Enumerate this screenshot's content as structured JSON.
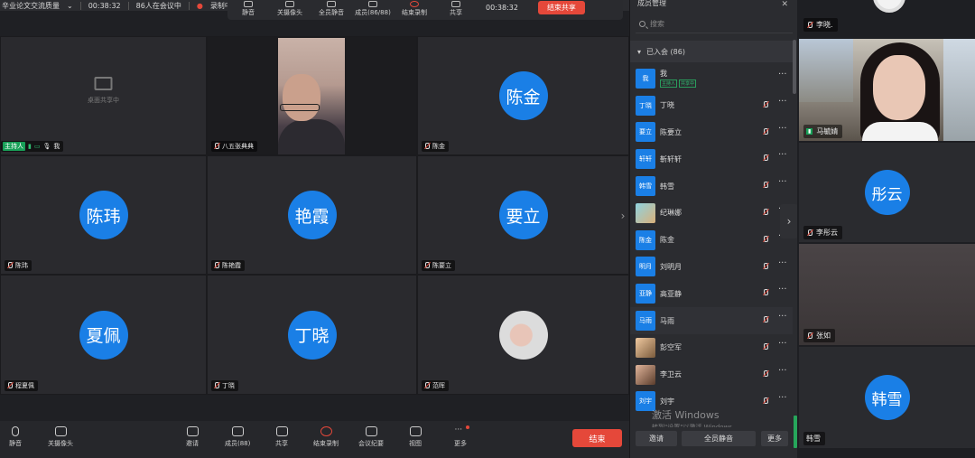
{
  "topbar": {
    "meeting_title": "辛业论文交流质量",
    "duration": "00:38:32",
    "attendee_status": "86人在会议中",
    "recording_label": "录制中"
  },
  "top_toolbar": {
    "items": [
      "静音",
      "关摄像头",
      "全员静音",
      "成员(86/88)",
      "结束录制",
      "共享"
    ],
    "time": "00:38:32",
    "end_share": "结束共享"
  },
  "grid": {
    "tiles": [
      {
        "name": "我",
        "type": "share",
        "share_text": "桌面共享中",
        "host_tag": "主持人"
      },
      {
        "name": "八五张典典",
        "type": "video"
      },
      {
        "name": "陈金",
        "avatar": "陈金"
      },
      {
        "name": "陈玮",
        "avatar": "陈玮"
      },
      {
        "name": "陈艳霞",
        "avatar": "艳霞"
      },
      {
        "name": "陈要立",
        "avatar": "要立"
      },
      {
        "name": "程夏佩",
        "avatar": "夏佩"
      },
      {
        "name": "丁晓",
        "avatar": "丁晓"
      },
      {
        "name": "范晖",
        "type": "image"
      }
    ]
  },
  "bottombar": {
    "mute": "静音",
    "camera": "关摄像头",
    "invite": "邀请",
    "members": "成员(88)",
    "share": "共享",
    "stop_record": "结束录制",
    "minutes": "会议纪要",
    "view": "视图",
    "more": "更多",
    "end": "结束"
  },
  "panel": {
    "title": "成员管理",
    "search_placeholder": "搜索",
    "section": "已入会 (86)",
    "members": [
      {
        "avatar": "我",
        "name": "我",
        "tags": [
          "主持人",
          "共享中"
        ]
      },
      {
        "avatar": "丁晓",
        "name": "丁晓"
      },
      {
        "avatar": "要立",
        "name": "陈要立"
      },
      {
        "avatar": "轩轩",
        "name": "靳轩轩"
      },
      {
        "avatar": "韩雪",
        "name": "韩雪"
      },
      {
        "avatar": "",
        "name": "纪琳娜",
        "photo": "ph1"
      },
      {
        "avatar": "陈金",
        "name": "陈金"
      },
      {
        "avatar": "明月",
        "name": "刘明月"
      },
      {
        "avatar": "亚静",
        "name": "高亚静"
      },
      {
        "avatar": "马雨",
        "name": "马雨"
      },
      {
        "avatar": "",
        "name": "彭空军",
        "photo": "ph2"
      },
      {
        "avatar": "",
        "name": "李卫云",
        "photo": "ph3"
      },
      {
        "avatar": "刘宇",
        "name": "刘宇"
      }
    ],
    "watermark_line1": "激活 Windows",
    "watermark_line2": "转到\"设置\"以激活 Windows。",
    "invite": "邀请",
    "mute_all": "全员静音",
    "more": "更多"
  },
  "gallery": {
    "tiles": [
      {
        "name": "李晓."
      },
      {
        "name": "马毓婧",
        "type": "video"
      },
      {
        "name": "李彤云",
        "avatar": "彤云"
      },
      {
        "name": "张如",
        "type": "blank"
      },
      {
        "name": "韩雪",
        "avatar": "韩雪"
      }
    ]
  },
  "colors": {
    "accent": "#1a7fe6",
    "end": "#e5483a",
    "host": "#18a058"
  }
}
